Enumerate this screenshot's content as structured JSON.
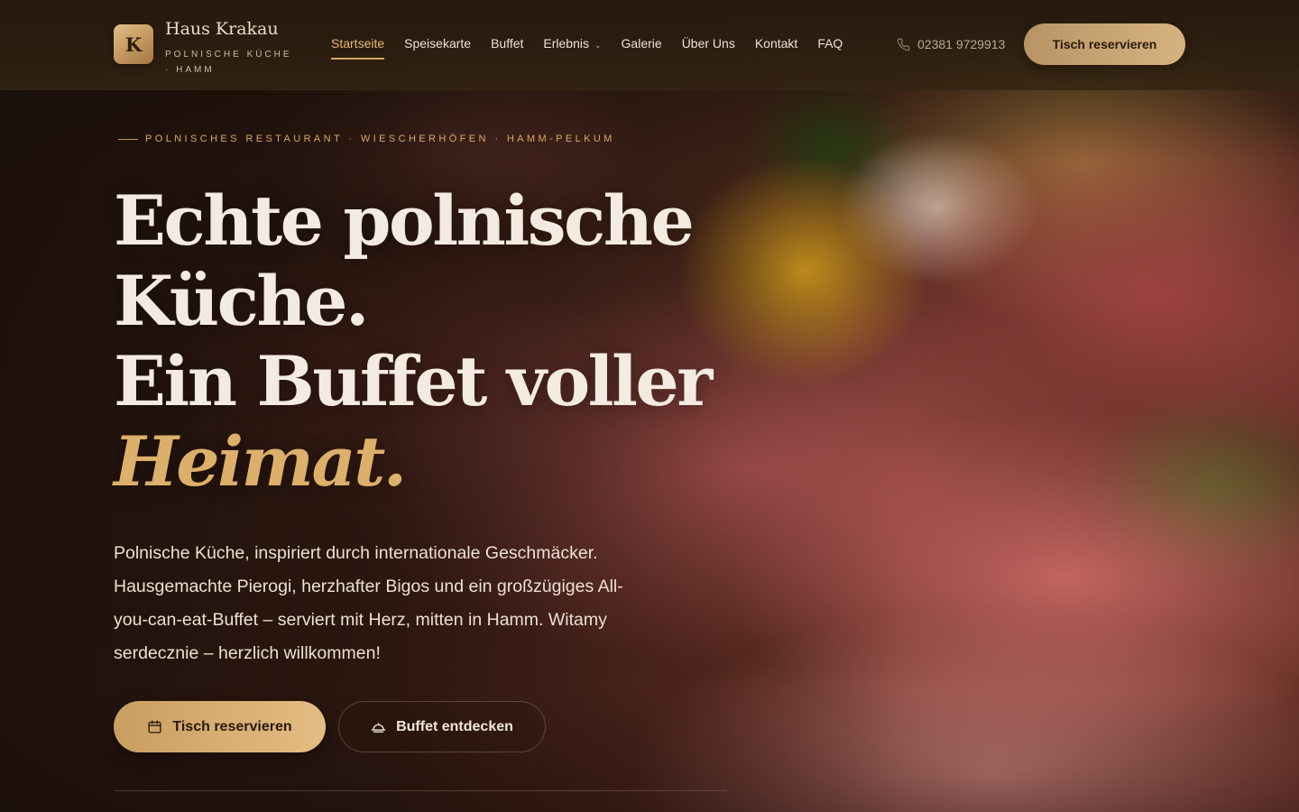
{
  "brand": {
    "initial": "K",
    "name": "Haus Krakau",
    "tagline": "POLNISCHE KÜCHE · HAMM"
  },
  "nav": {
    "items": [
      {
        "label": "Startseite",
        "active": true
      },
      {
        "label": "Speisekarte"
      },
      {
        "label": "Buffet"
      },
      {
        "label": "Erlebnis",
        "dropdown": true
      },
      {
        "label": "Galerie"
      },
      {
        "label": "Über Uns"
      },
      {
        "label": "Kontakt"
      },
      {
        "label": "FAQ"
      }
    ],
    "phone": "02381 9729913",
    "phone_icon": "phone-icon",
    "cta_label": "Tisch reservieren"
  },
  "hero": {
    "eyebrow": "POLNISCHES RESTAURANT · WIESCHERHÖFEN · HAMM-PELKUM",
    "headline_line1": "Echte polnische",
    "headline_line2": "Küche.",
    "headline_line3": "Ein Buffet voller",
    "headline_accent": "Heimat.",
    "lead": "Polnische Küche, inspiriert durch internationale Geschmäcker. Hausgemachte Pierogi, herzhafter Bigos und ein großzügiges All-you-can-eat-Buffet – serviert mit Herz, mitten in Hamm. Witamy serdecznie – herzlich willkommen!",
    "primary_cta": "Tisch reservieren",
    "primary_icon": "calendar-icon",
    "secondary_cta": "Buffet entdecken",
    "secondary_icon": "cloche-icon"
  },
  "colors": {
    "accent": "#dcb06a",
    "cta_gradient_start": "#c99e61",
    "cta_gradient_end": "#e4bd84",
    "text_light": "#f3ebe1",
    "header_bg": "#2c1f10"
  }
}
